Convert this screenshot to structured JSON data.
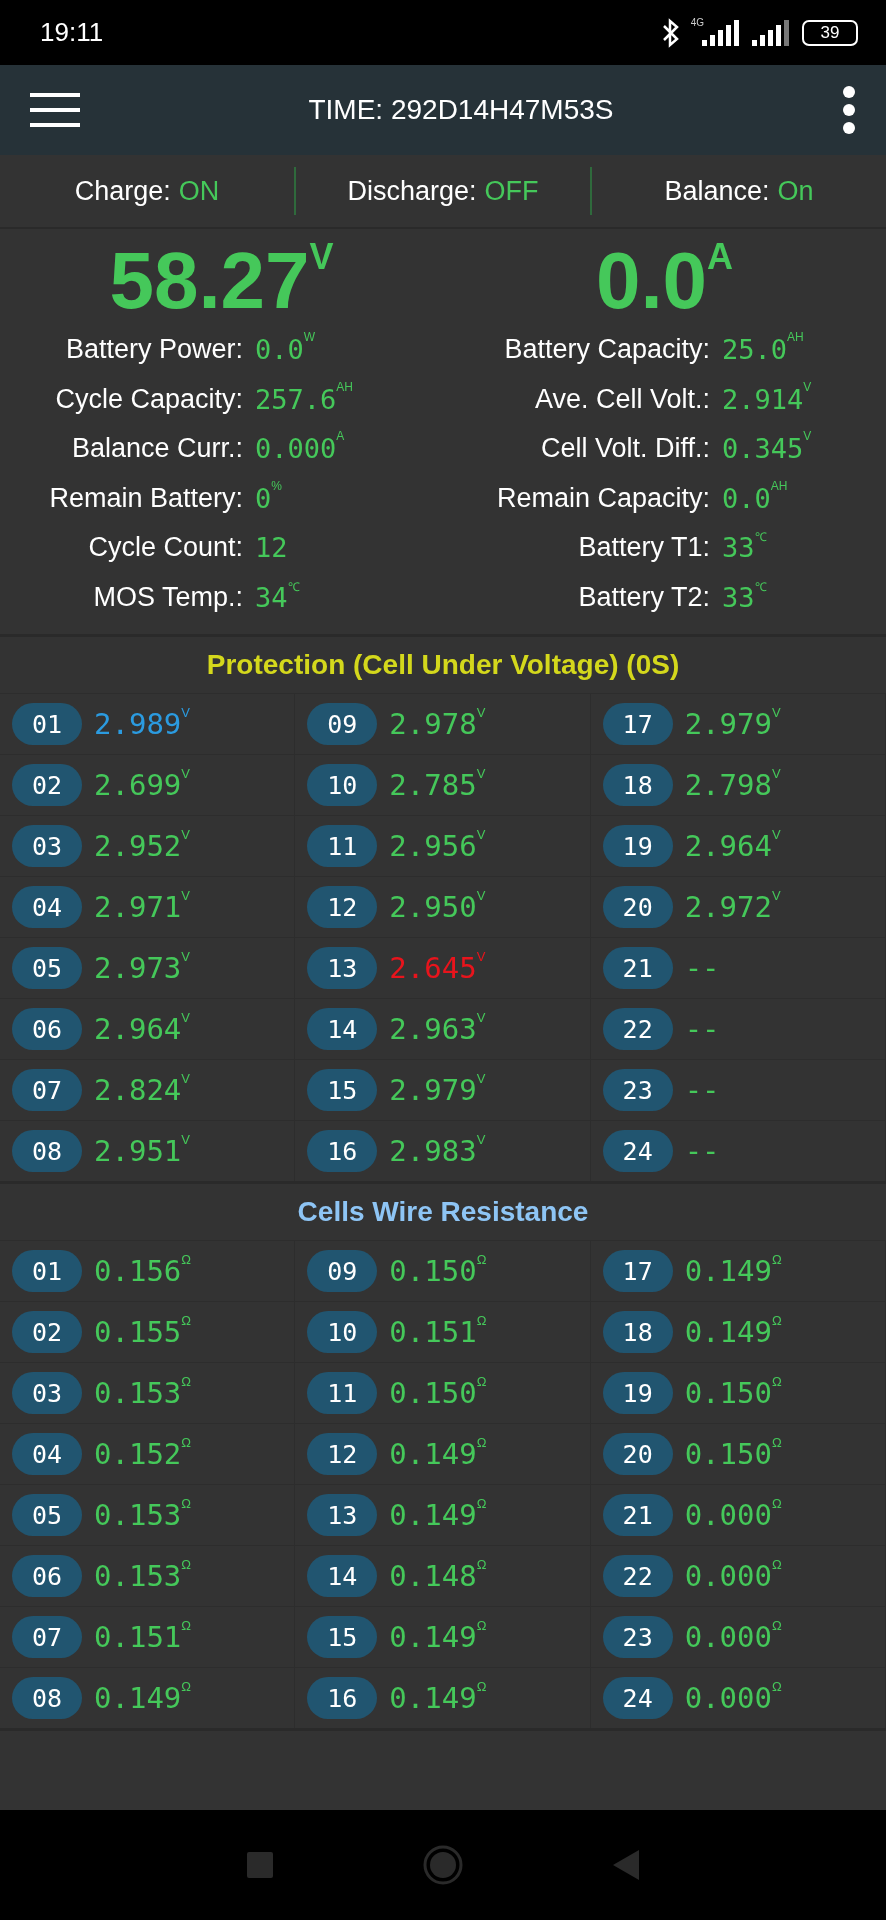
{
  "status_bar": {
    "time": "19:11",
    "network": "4G",
    "battery": "39"
  },
  "header": {
    "title": "TIME: 292D14H47M53S"
  },
  "switches": [
    {
      "label": "Charge:",
      "value": "ON"
    },
    {
      "label": "Discharge:",
      "value": "OFF"
    },
    {
      "label": "Balance:",
      "value": "On"
    }
  ],
  "main_readings": [
    {
      "value": "58.27",
      "unit": "V"
    },
    {
      "value": "0.0",
      "unit": "A"
    }
  ],
  "stats_left": [
    {
      "label": "Battery Power:",
      "value": "0.0",
      "unit": "W"
    },
    {
      "label": "Cycle Capacity:",
      "value": "257.6",
      "unit": "AH"
    },
    {
      "label": "Balance Curr.:",
      "value": "0.000",
      "unit": "A"
    },
    {
      "label": "Remain Battery:",
      "value": "0",
      "unit": "%"
    },
    {
      "label": "Cycle Count:",
      "value": "12"
    },
    {
      "label": "MOS Temp.:",
      "value": "34",
      "unit": "℃"
    }
  ],
  "stats_right": [
    {
      "label": "Battery Capacity:",
      "value": "25.0",
      "unit": "AH"
    },
    {
      "label": "Ave. Cell Volt.:",
      "value": "2.914",
      "unit": "V"
    },
    {
      "label": "Cell Volt. Diff.:",
      "value": "0.345",
      "unit": "V"
    },
    {
      "label": "Remain Capacity:",
      "value": "0.0",
      "unit": "AH"
    },
    {
      "label": "Battery T1:",
      "value": "33",
      "unit": "℃"
    },
    {
      "label": "Battery T2:",
      "value": "33",
      "unit": "℃"
    }
  ],
  "sections": [
    {
      "title": "Protection (Cell Under Voltage) (0S)",
      "color": "#d4d81c",
      "cells": [
        {
          "index": "01",
          "value": "2.989",
          "unit": "V",
          "color": "#2b9be0"
        },
        {
          "index": "02",
          "value": "2.699",
          "unit": "V",
          "color": "#45c85a"
        },
        {
          "index": "03",
          "value": "2.952",
          "unit": "V",
          "color": "#45c85a"
        },
        {
          "index": "04",
          "value": "2.971",
          "unit": "V",
          "color": "#45c85a"
        },
        {
          "index": "05",
          "value": "2.973",
          "unit": "V",
          "color": "#45c85a"
        },
        {
          "index": "06",
          "value": "2.964",
          "unit": "V",
          "color": "#45c85a"
        },
        {
          "index": "07",
          "value": "2.824",
          "unit": "V",
          "color": "#45c85a"
        },
        {
          "index": "08",
          "value": "2.951",
          "unit": "V",
          "color": "#45c85a"
        },
        {
          "index": "09",
          "value": "2.978",
          "unit": "V",
          "color": "#45c85a"
        },
        {
          "index": "10",
          "value": "2.785",
          "unit": "V",
          "color": "#45c85a"
        },
        {
          "index": "11",
          "value": "2.956",
          "unit": "V",
          "color": "#45c85a"
        },
        {
          "index": "12",
          "value": "2.950",
          "unit": "V",
          "color": "#45c85a"
        },
        {
          "index": "13",
          "value": "2.645",
          "unit": "V",
          "color": "#e8141c"
        },
        {
          "index": "14",
          "value": "2.963",
          "unit": "V",
          "color": "#45c85a"
        },
        {
          "index": "15",
          "value": "2.979",
          "unit": "V",
          "color": "#45c85a"
        },
        {
          "index": "16",
          "value": "2.983",
          "unit": "V",
          "color": "#45c85a"
        },
        {
          "index": "17",
          "value": "2.979",
          "unit": "V",
          "color": "#45c85a"
        },
        {
          "index": "18",
          "value": "2.798",
          "unit": "V",
          "color": "#45c85a"
        },
        {
          "index": "19",
          "value": "2.964",
          "unit": "V",
          "color": "#45c85a"
        },
        {
          "index": "20",
          "value": "2.972",
          "unit": "V",
          "color": "#45c85a"
        },
        {
          "index": "21",
          "value": "--",
          "color": "#45c85a"
        },
        {
          "index": "22",
          "value": "--",
          "color": "#45c85a"
        },
        {
          "index": "23",
          "value": "--",
          "color": "#45c85a"
        },
        {
          "index": "24",
          "value": "--",
          "color": "#45c85a"
        }
      ]
    },
    {
      "title": "Cells Wire Resistance",
      "color": "#8ec5f5",
      "cells": [
        {
          "index": "01",
          "value": "0.156",
          "unit": "Ω",
          "color": "#45c85a"
        },
        {
          "index": "02",
          "value": "0.155",
          "unit": "Ω",
          "color": "#45c85a"
        },
        {
          "index": "03",
          "value": "0.153",
          "unit": "Ω",
          "color": "#45c85a"
        },
        {
          "index": "04",
          "value": "0.152",
          "unit": "Ω",
          "color": "#45c85a"
        },
        {
          "index": "05",
          "value": "0.153",
          "unit": "Ω",
          "color": "#45c85a"
        },
        {
          "index": "06",
          "value": "0.153",
          "unit": "Ω",
          "color": "#45c85a"
        },
        {
          "index": "07",
          "value": "0.151",
          "unit": "Ω",
          "color": "#45c85a"
        },
        {
          "index": "08",
          "value": "0.149",
          "unit": "Ω",
          "color": "#45c85a"
        },
        {
          "index": "09",
          "value": "0.150",
          "unit": "Ω",
          "color": "#45c85a"
        },
        {
          "index": "10",
          "value": "0.151",
          "unit": "Ω",
          "color": "#45c85a"
        },
        {
          "index": "11",
          "value": "0.150",
          "unit": "Ω",
          "color": "#45c85a"
        },
        {
          "index": "12",
          "value": "0.149",
          "unit": "Ω",
          "color": "#45c85a"
        },
        {
          "index": "13",
          "value": "0.149",
          "unit": "Ω",
          "color": "#45c85a"
        },
        {
          "index": "14",
          "value": "0.148",
          "unit": "Ω",
          "color": "#45c85a"
        },
        {
          "index": "15",
          "value": "0.149",
          "unit": "Ω",
          "color": "#45c85a"
        },
        {
          "index": "16",
          "value": "0.149",
          "unit": "Ω",
          "color": "#45c85a"
        },
        {
          "index": "17",
          "value": "0.149",
          "unit": "Ω",
          "color": "#45c85a"
        },
        {
          "index": "18",
          "value": "0.149",
          "unit": "Ω",
          "color": "#45c85a"
        },
        {
          "index": "19",
          "value": "0.150",
          "unit": "Ω",
          "color": "#45c85a"
        },
        {
          "index": "20",
          "value": "0.150",
          "unit": "Ω",
          "color": "#45c85a"
        },
        {
          "index": "21",
          "value": "0.000",
          "unit": "Ω",
          "color": "#45c85a"
        },
        {
          "index": "22",
          "value": "0.000",
          "unit": "Ω",
          "color": "#45c85a"
        },
        {
          "index": "23",
          "value": "0.000",
          "unit": "Ω",
          "color": "#45c85a"
        },
        {
          "index": "24",
          "value": "0.000",
          "unit": "Ω",
          "color": "#45c85a"
        }
      ]
    }
  ]
}
